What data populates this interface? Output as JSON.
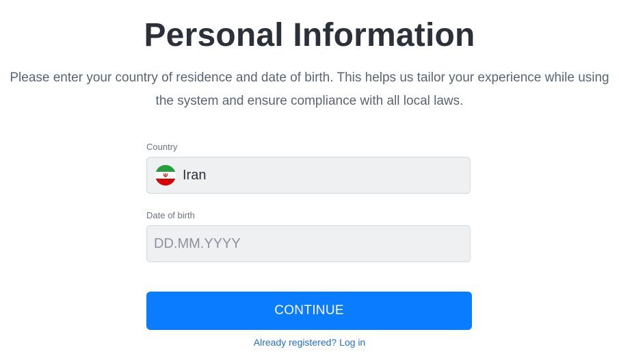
{
  "page": {
    "title": "Personal Information",
    "description": "Please enter your country of residence and date of birth. This helps us tailor your experience while using the system and ensure compliance with all local laws."
  },
  "form": {
    "country": {
      "label": "Country",
      "value": "Iran",
      "flag_icon": "iran-flag-icon"
    },
    "dob": {
      "label": "Date of birth",
      "value": "",
      "placeholder": "DD.MM.YYYY"
    },
    "continue_label": "CONTINUE",
    "login_link": "Already registered? Log in"
  },
  "colors": {
    "primary": "#0a7cff",
    "title": "#2c3038",
    "field_bg": "#eff0f2",
    "link": "#1f6fd6"
  }
}
